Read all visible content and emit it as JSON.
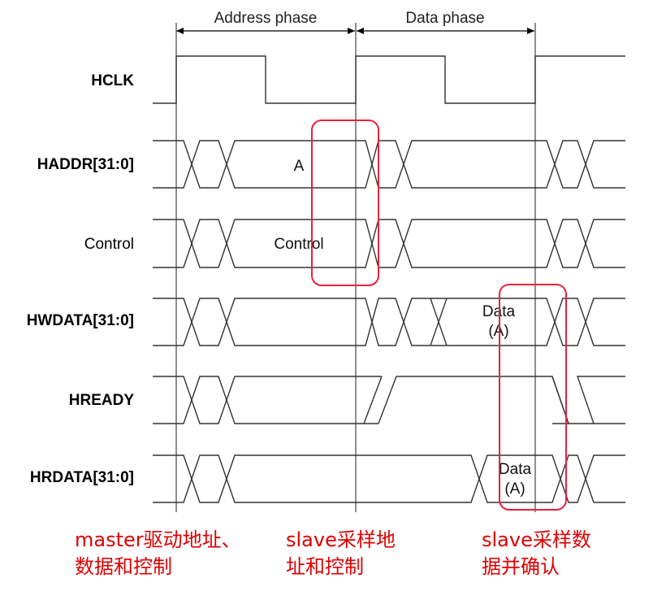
{
  "phases": {
    "address": "Address phase",
    "data": "Data phase"
  },
  "signals": {
    "hclk": "HCLK",
    "haddr": "HADDR[31:0]",
    "control": "Control",
    "hwdata": "HWDATA[31:0]",
    "hready": "HREADY",
    "hrdata": "HRDATA[31:0]"
  },
  "values": {
    "haddr": "A",
    "control": "Control",
    "hwdata_line1": "Data",
    "hwdata_line2": "(A)",
    "hrdata_line1": "Data",
    "hrdata_line2": "(A)"
  },
  "annotations": {
    "master_line1": "master驱动地址、",
    "master_line2": "数据和控制",
    "slave_addr_line1": "slave采样地",
    "slave_addr_line2": "址和控制",
    "slave_data_line1": "slave采样数",
    "slave_data_line2": "据并确认"
  },
  "colors": {
    "annotation": "#e00000",
    "highlight": "#e8223b",
    "waveform": "#333333"
  }
}
